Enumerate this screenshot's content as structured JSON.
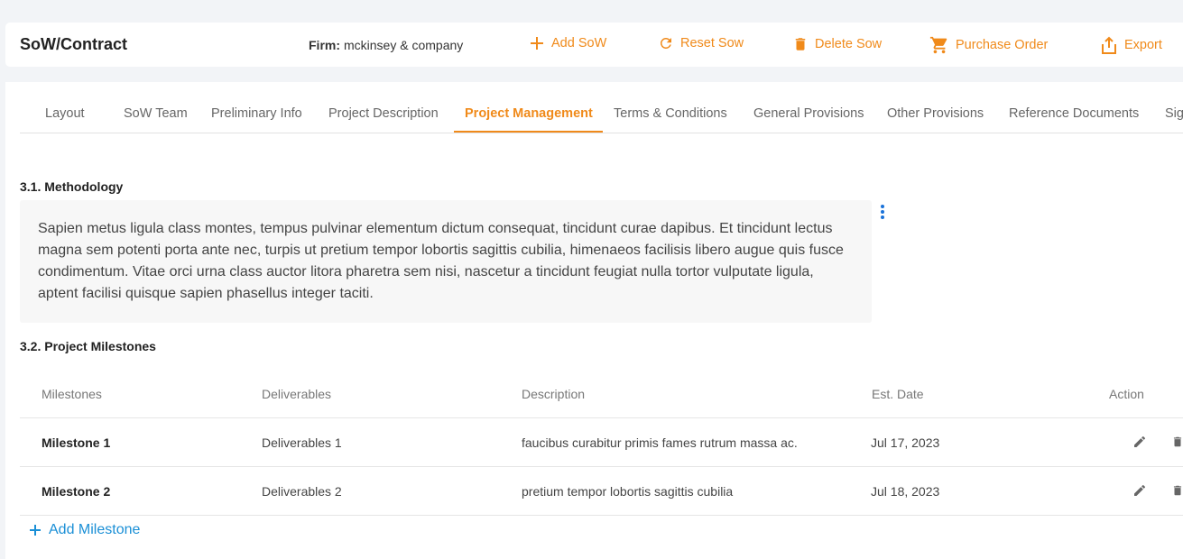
{
  "header": {
    "title": "SoW/Contract",
    "firm_label": "Firm:",
    "firm_value": "mckinsey & company",
    "actions": [
      {
        "label": "Add SoW",
        "icon": "plus-icon"
      },
      {
        "label": "Reset Sow",
        "icon": "refresh-icon"
      },
      {
        "label": "Delete Sow",
        "icon": "trash-icon"
      },
      {
        "label": "Purchase Order",
        "icon": "cart-icon"
      },
      {
        "label": "Export",
        "icon": "export-icon"
      }
    ],
    "accent_color": "#f08a1a"
  },
  "tabs": [
    {
      "label": "Layout"
    },
    {
      "label": "SoW Team"
    },
    {
      "label": "Preliminary Info"
    },
    {
      "label": "Project Description"
    },
    {
      "label": "Project Management",
      "active": true
    },
    {
      "label": "Terms & Conditions"
    },
    {
      "label": "General Provisions"
    },
    {
      "label": "Other Provisions"
    },
    {
      "label": "Reference Documents"
    },
    {
      "label": "Sig"
    }
  ],
  "methodology": {
    "title": "3.1. Methodology",
    "text": "Sapien metus ligula class montes, tempus pulvinar elementum dictum consequat, tincidunt curae dapibus. Et tincidunt lectus magna sem potenti porta ante nec, turpis ut pretium tempor lobortis sagittis cubilia, himenaeos facilisis libero augue quis fusce condimentum. Vitae orci urna class auctor litora pharetra sem nisi, nascetur a tincidunt feugiat nulla tortor vulputate ligula, aptent facilisi quisque sapien phasellus integer taciti."
  },
  "milestones": {
    "title": "3.2. Project Milestones",
    "columns": [
      "Milestones",
      "Deliverables",
      "Description",
      "Est. Date",
      "Action"
    ],
    "rows": [
      {
        "milestone": "Milestone 1",
        "deliverable": "Deliverables 1",
        "description": "faucibus curabitur primis fames rutrum massa ac.",
        "date": "Jul 17, 2023"
      },
      {
        "milestone": "Milestone 2",
        "deliverable": "Deliverables 2",
        "description": "pretium tempor lobortis sagittis cubilia",
        "date": "Jul 18, 2023"
      }
    ],
    "add_label": "Add Milestone",
    "link_color": "#1a8fd6"
  }
}
